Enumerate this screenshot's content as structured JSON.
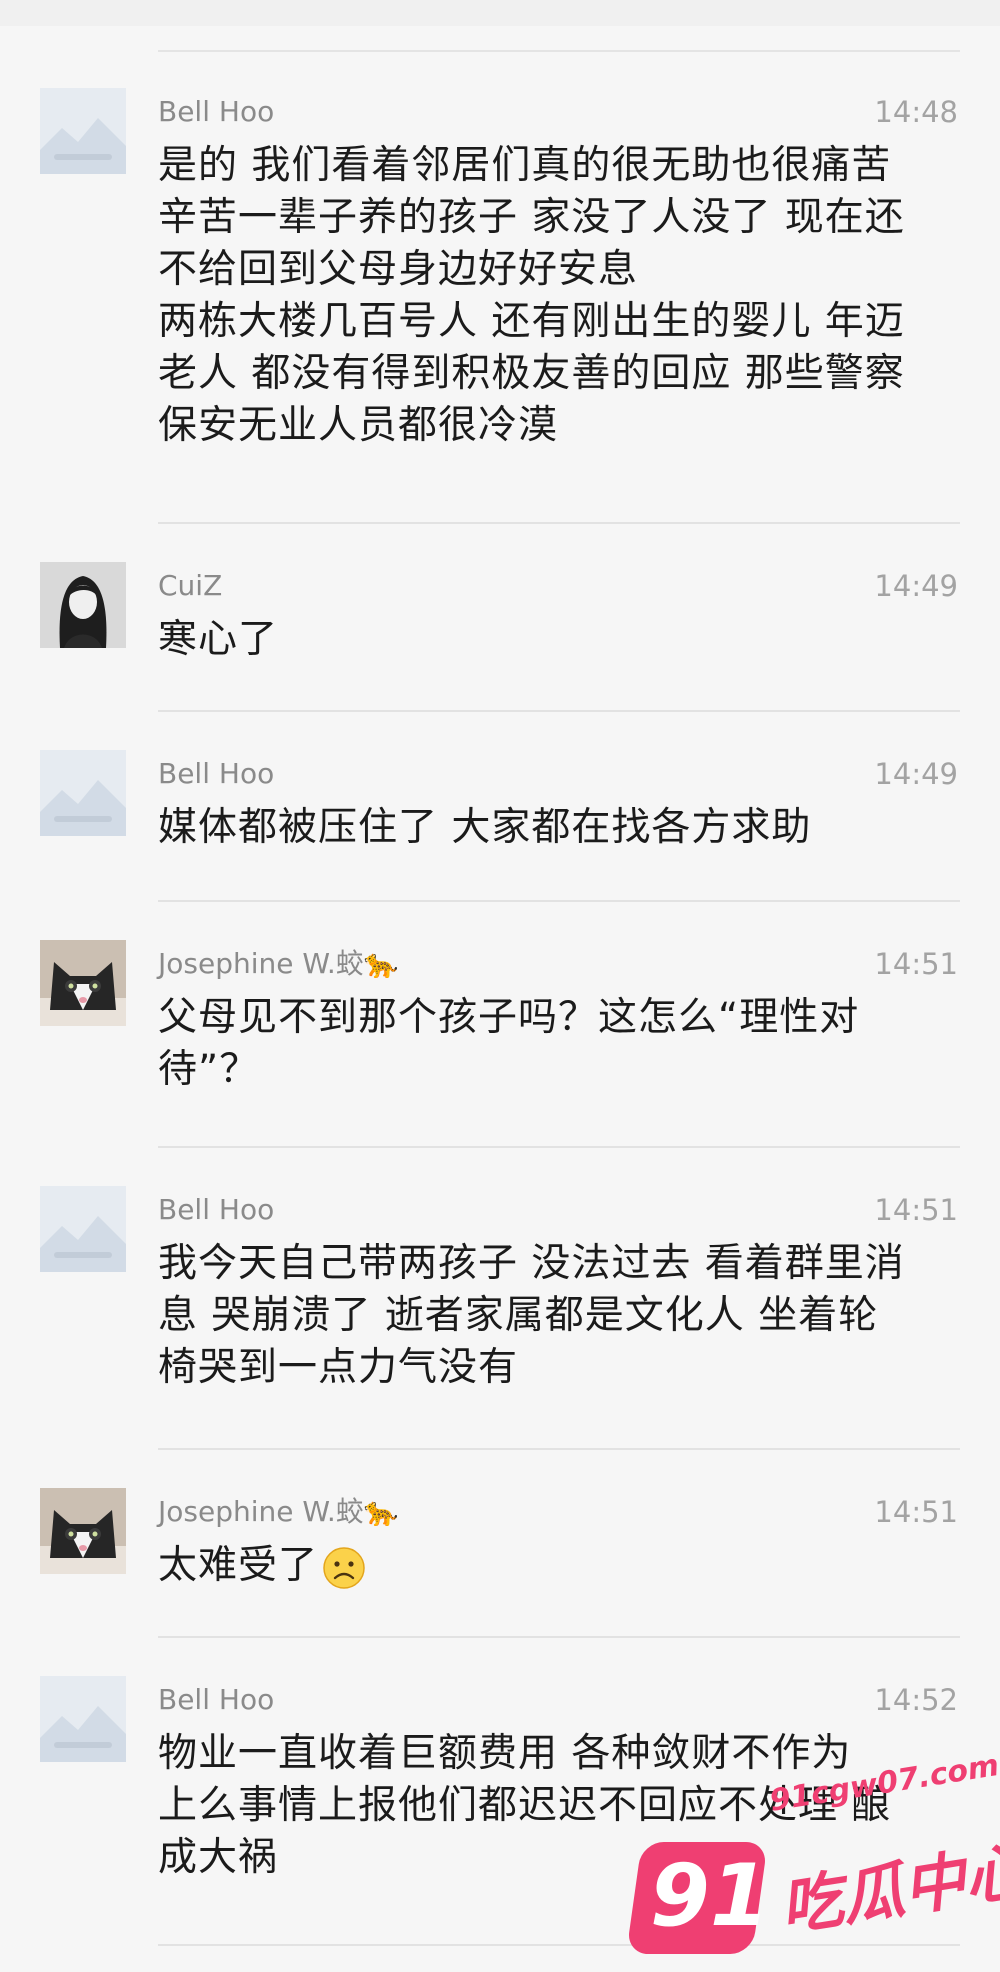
{
  "comments": [
    {
      "name": "Bell Hoo",
      "time": "14:48",
      "avatar": "placeholder-avatar",
      "lines": [
        "是的 我们看着邻居们真的很无助也很痛苦",
        "辛苦一辈子养的孩子 家没了人没了 现在还",
        "不给回到父母身边好好安息",
        "两栋大楼几百号人 还有刚出生的婴儿 年迈",
        "老人 都没有得到积极友善的回应 那些警察",
        "保安无业人员都很冷漠"
      ]
    },
    {
      "name": "CuiZ",
      "time": "14:49",
      "avatar": "portrait-avatar",
      "lines": [
        "寒心了"
      ]
    },
    {
      "name": "Bell Hoo",
      "time": "14:49",
      "avatar": "placeholder-avatar",
      "lines": [
        "媒体都被压住了 大家都在找各方求助"
      ]
    },
    {
      "name": "Josephine W.蛟🐆",
      "time": "14:51",
      "avatar": "cat-avatar",
      "lines": [
        "父母见不到那个孩子吗？这怎么“理性对",
        "待”？"
      ]
    },
    {
      "name": "Bell Hoo",
      "time": "14:51",
      "avatar": "placeholder-avatar",
      "lines": [
        "我今天自己带两孩子 没法过去 看着群里消",
        "息 哭崩溃了 逝者家属都是文化人 坐着轮",
        "椅哭到一点力气没有"
      ]
    },
    {
      "name": "Josephine W.蛟🐆",
      "time": "14:51",
      "avatar": "cat-avatar",
      "lines": [
        "太难受了"
      ],
      "emoji": "sad-face-emoji"
    },
    {
      "name": "Bell Hoo",
      "time": "14:52",
      "avatar": "placeholder-avatar",
      "lines": [
        "物业一直收着巨额费用 各种敛财不作为",
        "上么事情上报他们都迟迟不回应不处理 酿",
        "成大祸"
      ]
    }
  ],
  "watermark": {
    "number": "91",
    "url": "91cgw07.com",
    "text": "吃瓜中心",
    "color": "#ef3f72"
  }
}
